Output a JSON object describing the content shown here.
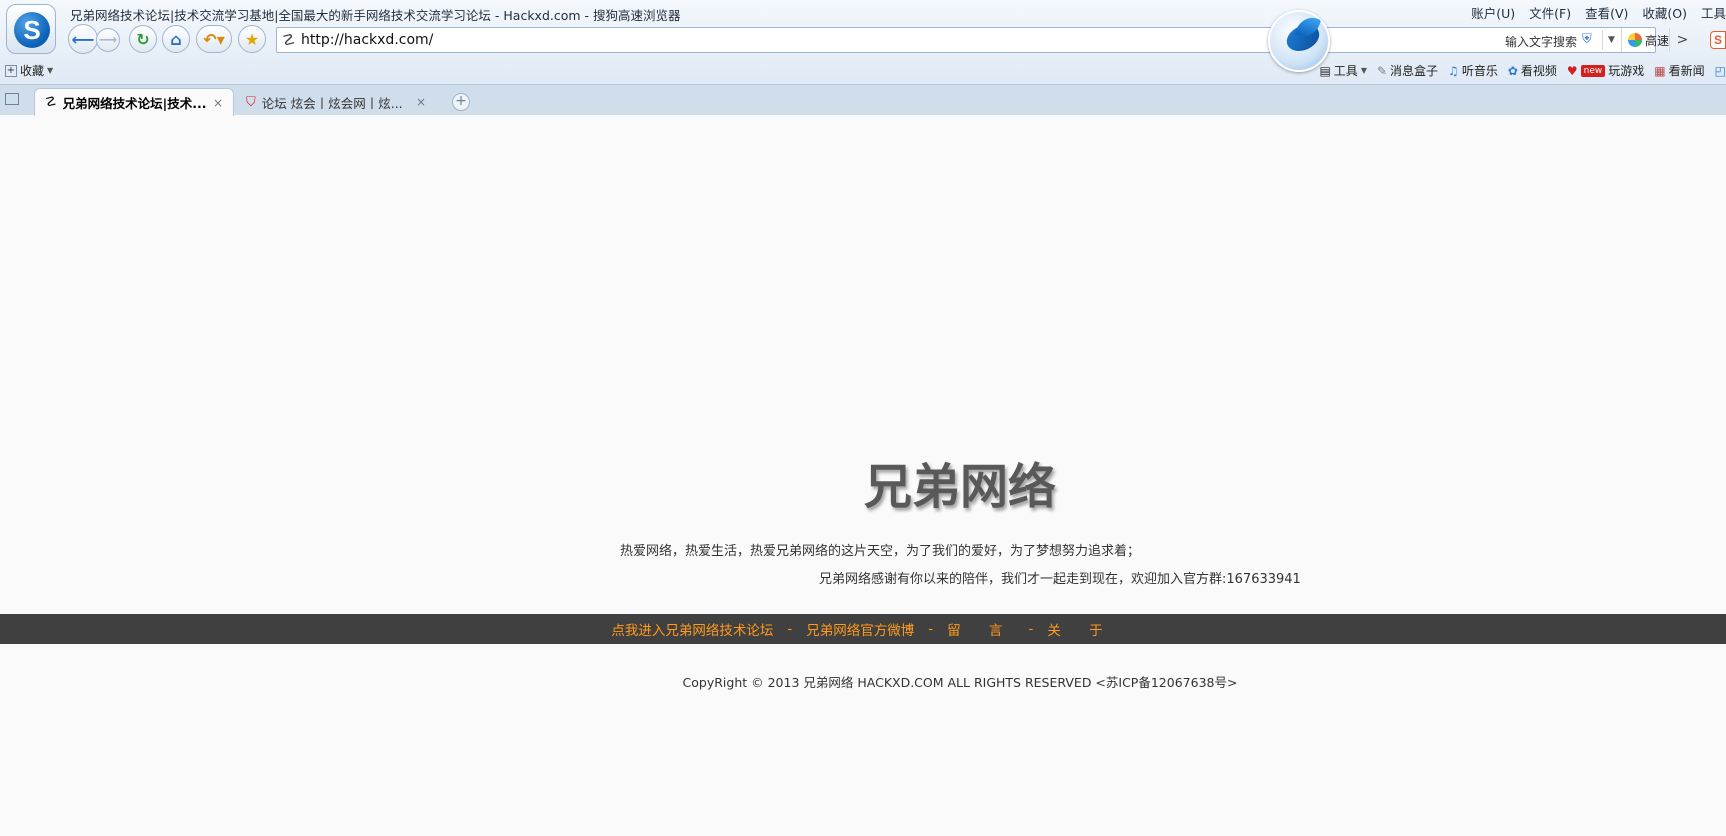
{
  "window": {
    "title": "兄弟网络技术论坛|技术交流学习基地|全国最大的新手网络技术交流学习论坛 - Hackxd.com - 搜狗高速浏览器",
    "menu": [
      "账户(U)",
      "文件(F)",
      "查看(V)",
      "收藏(O)",
      "工具"
    ]
  },
  "navigation": {
    "back_icon": "back-arrow-icon",
    "forward_icon": "forward-arrow-icon",
    "refresh_icon": "refresh-icon",
    "home_icon": "home-icon",
    "undo_icon": "undo-icon",
    "favorite_icon": "star-icon"
  },
  "address_bar": {
    "url": "http://hackxd.com/",
    "search_hint": "输入文字搜索",
    "speed_label": "高速",
    "go_symbol": ">"
  },
  "bookmark_bar": {
    "favorites_label": "收藏",
    "tools_label": "工具",
    "items": [
      {
        "label": "消息盒子",
        "icon": "message-box-icon"
      },
      {
        "label": "听音乐",
        "icon": "headphones-icon"
      },
      {
        "label": "看视频",
        "icon": "video-icon"
      },
      {
        "label": "玩游戏",
        "icon": "game-icon",
        "badge": "new"
      },
      {
        "label": "看新闻",
        "icon": "news-icon"
      }
    ]
  },
  "tabs": [
    {
      "label": "兄弟网络技术论坛|技术...",
      "active": true
    },
    {
      "label": "论坛 炫会丨炫会网丨炫...",
      "active": false
    }
  ],
  "page": {
    "title": "兄弟网络",
    "tagline_1": "热爱网络，热爱生活，热爱兄弟网络的这片天空，为了我们的爱好，为了梦想努力追求着；",
    "tagline_2": "兄弟网络感谢有你以来的陪伴，我们才一起走到现在，欢迎加入官方群:167633941",
    "nav": {
      "forum": "点我进入兄弟网络技术论坛",
      "weibo": "兄弟网络官方微博",
      "message": "留 言",
      "about": "关 于",
      "separator": "-"
    },
    "copyright": "CopyRight © 2013 兄弟网络 HACKXD.COM ALL RIGHTS RESERVED <苏ICP备12067638号>"
  },
  "colors": {
    "nav_band": "#404040",
    "nav_link": "#ff9a1e",
    "title_text": "#595959"
  }
}
